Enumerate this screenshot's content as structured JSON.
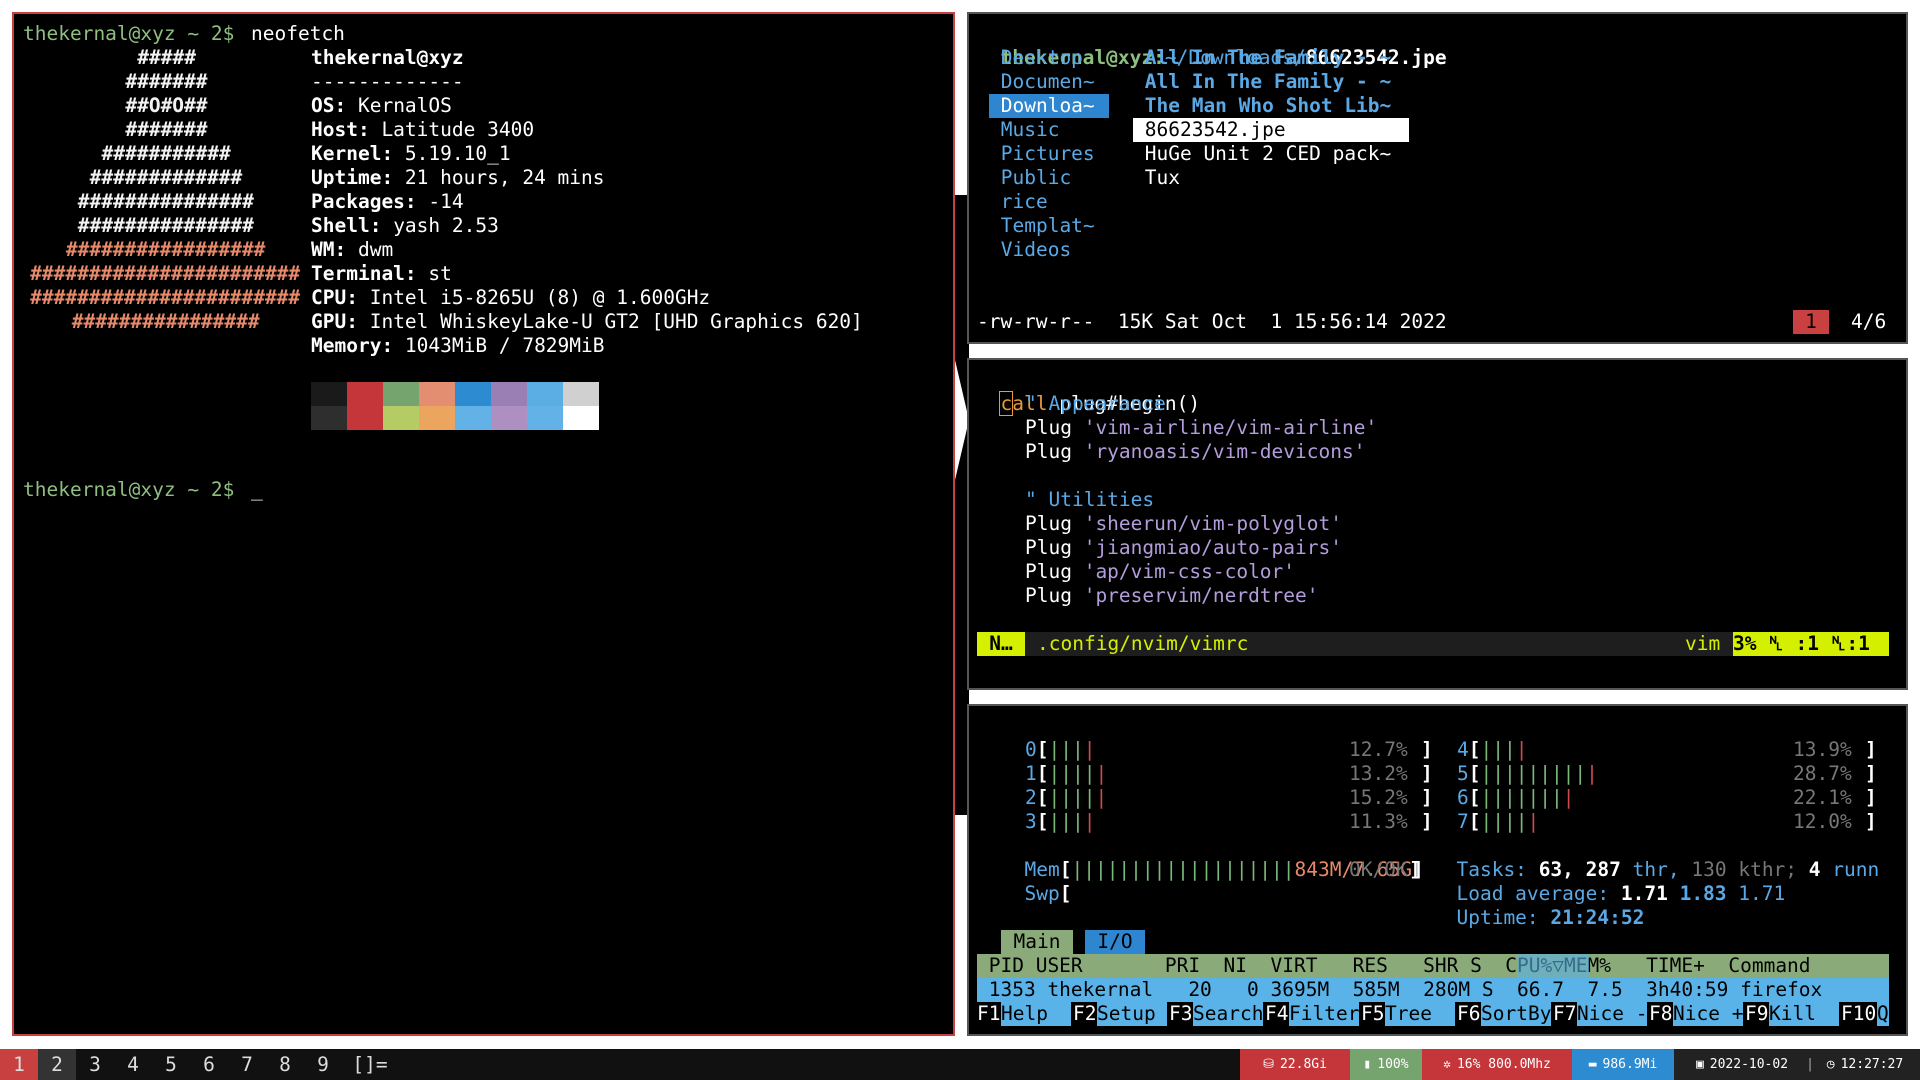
{
  "colors": {
    "prompt": "#8fbf7f",
    "active_border": "#c84040",
    "inactive_border": "#555555",
    "accent_blue": "#2f86d0",
    "vim_mode": "#d4f000"
  },
  "terminal": {
    "prompt": "thekernal@xyz ~ 2$",
    "command": "neofetch",
    "cursor": "_",
    "neofetch": {
      "ascii": [
        "#####",
        "#######",
        "##O#O##",
        "#######",
        "###########",
        "#############",
        "###############",
        "###############",
        "#################",
        "#######################",
        "#######################",
        "################"
      ],
      "user": "thekernal@xyz",
      "separator": "-------------",
      "fields": [
        {
          "key": "OS:",
          "value": "KernalOS"
        },
        {
          "key": "Host:",
          "value": "Latitude 3400"
        },
        {
          "key": "Kernel:",
          "value": "5.19.10_1"
        },
        {
          "key": "Uptime:",
          "value": "21 hours, 24 mins"
        },
        {
          "key": "Packages:",
          "value": "-14"
        },
        {
          "key": "Shell:",
          "value": "yash 2.53"
        },
        {
          "key": "WM:",
          "value": "dwm"
        },
        {
          "key": "Terminal:",
          "value": "st"
        },
        {
          "key": "CPU:",
          "value": "Intel i5-8265U (8) @ 1.600GHz"
        },
        {
          "key": "GPU:",
          "value": "Intel WhiskeyLake-U GT2 [UHD Graphics 620]"
        },
        {
          "key": "Memory:",
          "value": "1043MiB / 7829MiB"
        }
      ],
      "palette_top": [
        "#1a1a1a",
        "#c4363a",
        "#76a46f",
        "#e38e70",
        "#2d8bd1",
        "#9a7fb5",
        "#5aaee4",
        "#d0d0d0"
      ],
      "palette_bottom": [
        "#2e2e2e",
        "#c4363a",
        "#b5cc65",
        "#eba55f",
        "#62b2e8",
        "#ad8fc1",
        "#62b2e8",
        "#ffffff"
      ]
    }
  },
  "ranger": {
    "path_user": "thekernal@xyz:",
    "path_dir": "~/Downloads/",
    "path_file": "86623542.jpe",
    "dirs": [
      "Desktop",
      "Documen~",
      "Downloa~",
      "Music",
      "Pictures",
      "Public",
      "rice",
      "Templat~",
      "Videos"
    ],
    "selected_dir": "Downloa~",
    "files": [
      {
        "name": "All In The Family - ~",
        "kind": "dir"
      },
      {
        "name": "All In The Family - ~",
        "kind": "dir"
      },
      {
        "name": "The Man Who Shot Lib~",
        "kind": "dir"
      },
      {
        "name": "86623542.jpe",
        "kind": "selected"
      },
      {
        "name": "HuGe Unit 2 CED pack~",
        "kind": "file"
      },
      {
        "name": "Tux",
        "kind": "file"
      }
    ],
    "status_left": "-rw-rw-r--  15K Sat Oct  1 15:56:14 2022",
    "status_badge": "1",
    "status_count": "4/6"
  },
  "vim": {
    "first_char": "c",
    "first_rest": "all plug#begin()",
    "comment1": "\" Appearance",
    "plugs1": [
      "'vim-airline/vim-airline'",
      "'ryanoasis/vim-devicons'"
    ],
    "comment2": "\" Utilities",
    "plugs2": [
      "'sheerun/vim-polyglot'",
      "'jiangmiao/auto-pairs'",
      "'ap/vim-css-color'",
      "'preservim/nerdtree'"
    ],
    "plug_keyword": "Plug",
    "mode": "N…",
    "file": ".config/nvim/vimrc",
    "filetype": "vim",
    "position": "3% ␤ :1 ␤:1"
  },
  "htop": {
    "cpus_left": [
      {
        "id": "0",
        "bars": "||||",
        "pct": "12.7%"
      },
      {
        "id": "1",
        "bars": "|||||",
        "pct": "13.2%"
      },
      {
        "id": "2",
        "bars": "|||||",
        "pct": "15.2%"
      },
      {
        "id": "3",
        "bars": "||||",
        "pct": "11.3%"
      }
    ],
    "cpus_right": [
      {
        "id": "4",
        "bars": "||||",
        "pct": "13.9%"
      },
      {
        "id": "5",
        "bars": "||||||||||",
        "pct": "28.7%"
      },
      {
        "id": "6",
        "bars": "||||||||",
        "pct": "22.1%"
      },
      {
        "id": "7",
        "bars": "|||||",
        "pct": "12.0%"
      }
    ],
    "mem_label": "Mem",
    "mem_bars": "|||||||||||||||||||",
    "mem_value": "843M/7.65G",
    "swp_label": "Swp",
    "swp_value": "0K/0K",
    "tasks_label": "Tasks:",
    "tasks_value": "63,",
    "thr_value": "287",
    "thr_label": "thr,",
    "kthr": "130 kthr;",
    "running": "4",
    "running_label": "runn",
    "load_label": "Load average:",
    "load1": "1.71",
    "load5": "1.83",
    "load15": "1.71",
    "uptime_label": "Uptime:",
    "uptime_value": "21:24:52",
    "tabs": [
      "Main",
      "I/O"
    ],
    "header": " PID USER       PRI  NI  VIRT   RES   SHR S  CPU%▽MEM%   TIME+  Command",
    "process": " 1353 thekernal   20   0 3695M  585M  280M S  66.7  7.5  3h40:59 firefox",
    "fkeys": [
      {
        "k": "F1",
        "l": "Help  "
      },
      {
        "k": "F2",
        "l": "Setup "
      },
      {
        "k": "F3",
        "l": "Search"
      },
      {
        "k": "F4",
        "l": "Filter"
      },
      {
        "k": "F5",
        "l": "Tree  "
      },
      {
        "k": "F6",
        "l": "SortBy"
      },
      {
        "k": "F7",
        "l": "Nice -"
      },
      {
        "k": "F8",
        "l": "Nice +"
      },
      {
        "k": "F9",
        "l": "Kill  "
      },
      {
        "k": "F10",
        "l": "Q"
      }
    ]
  },
  "statusbar": {
    "tags": [
      "1",
      "2",
      "3",
      "4",
      "5",
      "6",
      "7",
      "8",
      "9"
    ],
    "active_tag": "1",
    "occupied_tag": "2",
    "layout": "[]=",
    "modules": [
      {
        "name": "disk",
        "icon": "⛁",
        "text": "22.8Gi",
        "color": "#c4363a"
      },
      {
        "name": "battery",
        "icon": "▮",
        "text": "100%",
        "color": "#76a46f"
      },
      {
        "name": "cpu",
        "icon": "✲",
        "text": "16% 800.0Mhz",
        "color": "#c4363a"
      },
      {
        "name": "memory",
        "icon": "▬",
        "text": "986.9Mi",
        "color": "#2d8bd1"
      },
      {
        "name": "date",
        "icon": "▣",
        "text": "2022-10-02",
        "color": "#222222"
      },
      {
        "name": "time",
        "icon": "◷",
        "text": "12:27:27",
        "color": "#222222"
      }
    ]
  }
}
